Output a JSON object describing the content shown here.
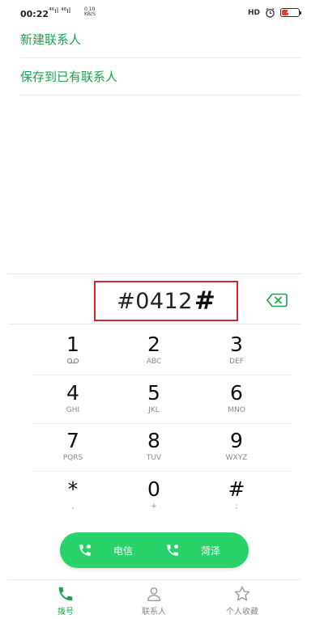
{
  "status": {
    "time": "00:22",
    "signal": "⁴⁶ıl ⁴⁶ıl",
    "speed_value": "0.10",
    "speed_unit": "KB/S",
    "hd": "HD",
    "battery_text": "18",
    "battery_level_percent": 18,
    "battery_color": "#e53935"
  },
  "options": [
    {
      "label": "新建联系人"
    },
    {
      "label": "保存到已有联系人"
    }
  ],
  "dial": {
    "number": "#0412",
    "hash_suffix": "#"
  },
  "keypad": [
    {
      "digit": "1",
      "letters": ""
    },
    {
      "digit": "2",
      "letters": "ABC"
    },
    {
      "digit": "3",
      "letters": "DEF"
    },
    {
      "digit": "4",
      "letters": "GHI"
    },
    {
      "digit": "5",
      "letters": "JKL"
    },
    {
      "digit": "6",
      "letters": "MNO"
    },
    {
      "digit": "7",
      "letters": "PQRS"
    },
    {
      "digit": "8",
      "letters": "TUV"
    },
    {
      "digit": "9",
      "letters": "WXYZ"
    },
    {
      "digit": "*",
      "letters": ","
    },
    {
      "digit": "0",
      "letters": "+"
    },
    {
      "digit": "#",
      "letters": ";"
    }
  ],
  "call_buttons": [
    {
      "label": "电信",
      "icon": "phone-sim1-icon"
    },
    {
      "label": "菏泽",
      "icon": "phone-sim2-icon"
    }
  ],
  "nav": [
    {
      "label": "拨号",
      "icon": "phone-icon",
      "active": true
    },
    {
      "label": "联系人",
      "icon": "person-icon",
      "active": false
    },
    {
      "label": "个人收藏",
      "icon": "star-icon",
      "active": false
    }
  ],
  "colors": {
    "accent": "#1aa34a",
    "call_button": "#2ad26a",
    "highlight_border": "#d0262b"
  }
}
